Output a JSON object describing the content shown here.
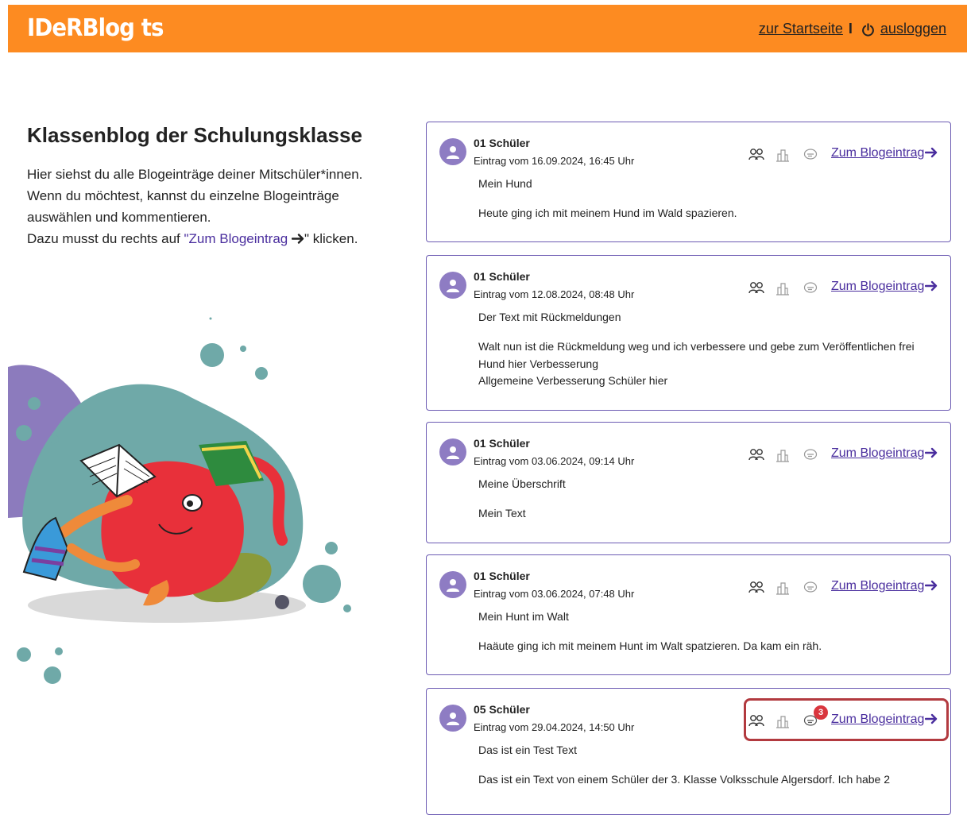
{
  "header": {
    "logo": "IDeRBlog ts",
    "home_link": "zur Startseite",
    "separator": "I",
    "logout_link": "ausloggen"
  },
  "intro": {
    "title": "Klassenblog der Schulungsklasse",
    "line1": "Hier siehst du alle Blogeinträge deiner Mitschüler*innen.",
    "line2": "Wenn du möchtest, kannst du einzelne Blogeinträge",
    "line3": "auswählen und kommentieren.",
    "line4_pre": "Dazu musst du rechts auf ",
    "line4_link": "\"Zum Blogeintrag ",
    "line4_post": "\" klicken."
  },
  "colors": {
    "header_bg": "#fd8b21",
    "accent": "#4a2e9e",
    "avatar": "#8e7cc3",
    "badge": "#d9363e",
    "highlight": "#b23a3f"
  },
  "entries": [
    {
      "author": "01 Schüler",
      "date": "Eintrag vom 16.09.2024, 16:45 Uhr",
      "title": "Mein Hund",
      "body": [
        "Heute ging ich mit meinem Hund im Wald spazieren."
      ],
      "link": "Zum Blogeintrag"
    },
    {
      "author": "01 Schüler",
      "date": "Eintrag vom 12.08.2024, 08:48 Uhr",
      "title": "Der Text mit Rückmeldungen",
      "body": [
        "Walt nun ist die Rückmeldung weg und ich verbessere und gebe zum Veröffentlichen frei",
        "Hund hier Verbesserung",
        "Allgemeine Verbesserung Schüler hier"
      ],
      "link": "Zum Blogeintrag"
    },
    {
      "author": "01 Schüler",
      "date": "Eintrag vom 03.06.2024, 09:14 Uhr",
      "title": "Meine Überschrift",
      "body": [
        "Mein Text"
      ],
      "link": "Zum Blogeintrag"
    },
    {
      "author": "01 Schüler",
      "date": "Eintrag vom 03.06.2024, 07:48 Uhr",
      "title": "Mein Hunt im Walt",
      "body": [
        "Haäute ging ich mit meinem Hunt im Walt spatzieren. Da kam ein räh."
      ],
      "link": "Zum Blogeintrag"
    },
    {
      "author": "05 Schüler",
      "date": "Eintrag vom 29.04.2024, 14:50 Uhr",
      "title": "Das ist ein Test Text",
      "body": [
        "Das ist ein Text von einem Schüler der 3. Klasse Volksschule Algersdorf. Ich habe 2"
      ],
      "link": "Zum Blogeintrag",
      "comment_count": "3"
    }
  ]
}
